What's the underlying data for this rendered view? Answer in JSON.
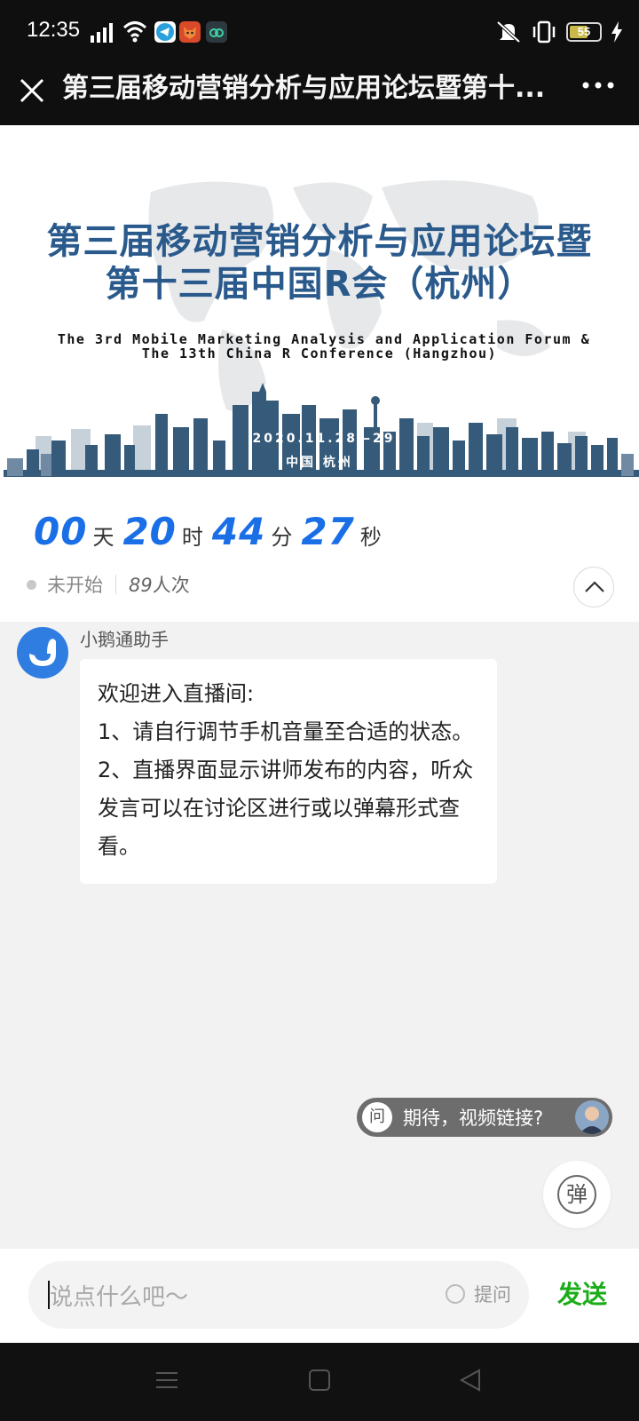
{
  "status_bar": {
    "time": "12:35",
    "battery": "55",
    "icons": [
      "signal-icon",
      "wifi-icon",
      "telegram-app-icon",
      "fox-app-icon",
      "cloud-app-icon",
      "mute-icon",
      "vibrate-icon",
      "battery-icon",
      "charging-icon"
    ]
  },
  "titlebar": {
    "title": "第三届移动营销分析与应用论坛暨第十..."
  },
  "banner": {
    "title_line1": "第三届移动营销分析与应用论坛暨",
    "title_line2": "第十三届中国R会（杭州）",
    "en_line1": "The 3rd Mobile Marketing Analysis and Application Forum &",
    "en_line2": "The 13th China R Conference (Hangzhou)",
    "date": "2020.11.28—29",
    "location": "中国  杭州",
    "colors": {
      "title": "#2a5a8c",
      "skyline": "#355a7a"
    }
  },
  "countdown": {
    "days": "00",
    "days_unit": "天",
    "hours": "20",
    "hours_unit": "时",
    "minutes": "44",
    "minutes_unit": "分",
    "seconds": "27",
    "seconds_unit": "秒",
    "accent": "#1a6ee6"
  },
  "live_status": {
    "state": "未开始",
    "viewer_count": "89",
    "viewer_suffix": "人次"
  },
  "chat": {
    "sender": "小鹅通助手",
    "lines": [
      "欢迎进入直播间:",
      "1、请自行调节手机音量至合适的状态。",
      "2、直播界面显示讲师发布的内容，听众发言可以在讨论区进行或以弹幕形式查看。"
    ]
  },
  "danmaku": {
    "badge": "问",
    "text": "期待，视频链接?"
  },
  "danmaku_toggle": {
    "label": "弹"
  },
  "input": {
    "placeholder": "说点什么吧～",
    "ask_label": "提问",
    "send_label": "发送",
    "send_color": "#1aad19"
  },
  "nav": {
    "icons": [
      "menu-icon",
      "home-icon",
      "back-icon"
    ]
  }
}
